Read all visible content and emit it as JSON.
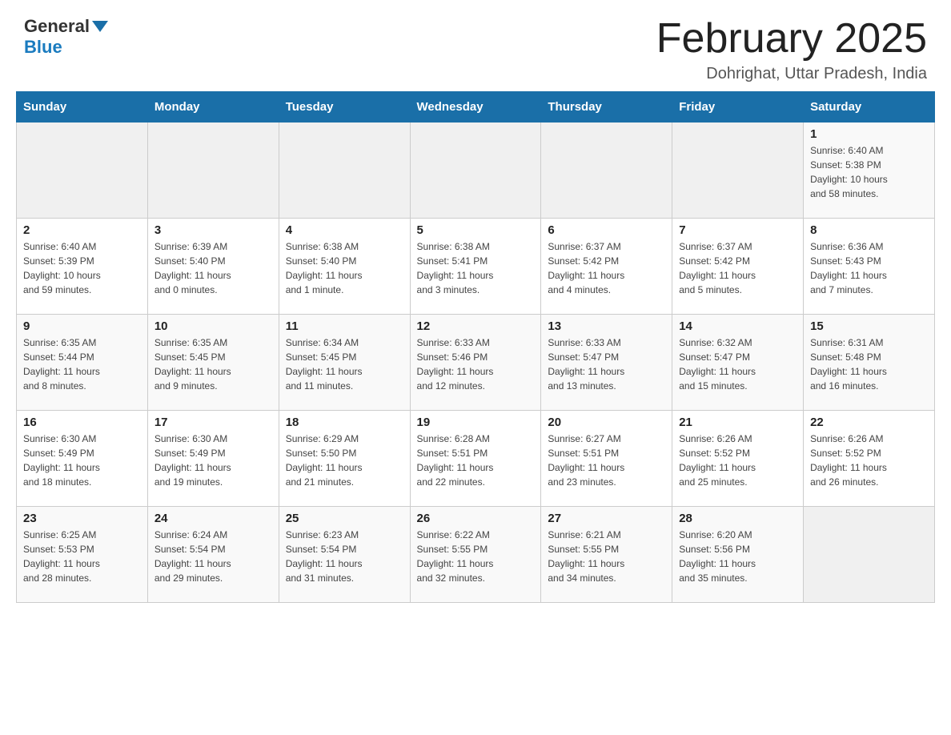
{
  "header": {
    "logo_general": "General",
    "logo_blue": "Blue",
    "month_title": "February 2025",
    "location": "Dohrighat, Uttar Pradesh, India"
  },
  "weekdays": [
    "Sunday",
    "Monday",
    "Tuesday",
    "Wednesday",
    "Thursday",
    "Friday",
    "Saturday"
  ],
  "weeks": [
    [
      {
        "day": "",
        "info": ""
      },
      {
        "day": "",
        "info": ""
      },
      {
        "day": "",
        "info": ""
      },
      {
        "day": "",
        "info": ""
      },
      {
        "day": "",
        "info": ""
      },
      {
        "day": "",
        "info": ""
      },
      {
        "day": "1",
        "info": "Sunrise: 6:40 AM\nSunset: 5:38 PM\nDaylight: 10 hours\nand 58 minutes."
      }
    ],
    [
      {
        "day": "2",
        "info": "Sunrise: 6:40 AM\nSunset: 5:39 PM\nDaylight: 10 hours\nand 59 minutes."
      },
      {
        "day": "3",
        "info": "Sunrise: 6:39 AM\nSunset: 5:40 PM\nDaylight: 11 hours\nand 0 minutes."
      },
      {
        "day": "4",
        "info": "Sunrise: 6:38 AM\nSunset: 5:40 PM\nDaylight: 11 hours\nand 1 minute."
      },
      {
        "day": "5",
        "info": "Sunrise: 6:38 AM\nSunset: 5:41 PM\nDaylight: 11 hours\nand 3 minutes."
      },
      {
        "day": "6",
        "info": "Sunrise: 6:37 AM\nSunset: 5:42 PM\nDaylight: 11 hours\nand 4 minutes."
      },
      {
        "day": "7",
        "info": "Sunrise: 6:37 AM\nSunset: 5:42 PM\nDaylight: 11 hours\nand 5 minutes."
      },
      {
        "day": "8",
        "info": "Sunrise: 6:36 AM\nSunset: 5:43 PM\nDaylight: 11 hours\nand 7 minutes."
      }
    ],
    [
      {
        "day": "9",
        "info": "Sunrise: 6:35 AM\nSunset: 5:44 PM\nDaylight: 11 hours\nand 8 minutes."
      },
      {
        "day": "10",
        "info": "Sunrise: 6:35 AM\nSunset: 5:45 PM\nDaylight: 11 hours\nand 9 minutes."
      },
      {
        "day": "11",
        "info": "Sunrise: 6:34 AM\nSunset: 5:45 PM\nDaylight: 11 hours\nand 11 minutes."
      },
      {
        "day": "12",
        "info": "Sunrise: 6:33 AM\nSunset: 5:46 PM\nDaylight: 11 hours\nand 12 minutes."
      },
      {
        "day": "13",
        "info": "Sunrise: 6:33 AM\nSunset: 5:47 PM\nDaylight: 11 hours\nand 13 minutes."
      },
      {
        "day": "14",
        "info": "Sunrise: 6:32 AM\nSunset: 5:47 PM\nDaylight: 11 hours\nand 15 minutes."
      },
      {
        "day": "15",
        "info": "Sunrise: 6:31 AM\nSunset: 5:48 PM\nDaylight: 11 hours\nand 16 minutes."
      }
    ],
    [
      {
        "day": "16",
        "info": "Sunrise: 6:30 AM\nSunset: 5:49 PM\nDaylight: 11 hours\nand 18 minutes."
      },
      {
        "day": "17",
        "info": "Sunrise: 6:30 AM\nSunset: 5:49 PM\nDaylight: 11 hours\nand 19 minutes."
      },
      {
        "day": "18",
        "info": "Sunrise: 6:29 AM\nSunset: 5:50 PM\nDaylight: 11 hours\nand 21 minutes."
      },
      {
        "day": "19",
        "info": "Sunrise: 6:28 AM\nSunset: 5:51 PM\nDaylight: 11 hours\nand 22 minutes."
      },
      {
        "day": "20",
        "info": "Sunrise: 6:27 AM\nSunset: 5:51 PM\nDaylight: 11 hours\nand 23 minutes."
      },
      {
        "day": "21",
        "info": "Sunrise: 6:26 AM\nSunset: 5:52 PM\nDaylight: 11 hours\nand 25 minutes."
      },
      {
        "day": "22",
        "info": "Sunrise: 6:26 AM\nSunset: 5:52 PM\nDaylight: 11 hours\nand 26 minutes."
      }
    ],
    [
      {
        "day": "23",
        "info": "Sunrise: 6:25 AM\nSunset: 5:53 PM\nDaylight: 11 hours\nand 28 minutes."
      },
      {
        "day": "24",
        "info": "Sunrise: 6:24 AM\nSunset: 5:54 PM\nDaylight: 11 hours\nand 29 minutes."
      },
      {
        "day": "25",
        "info": "Sunrise: 6:23 AM\nSunset: 5:54 PM\nDaylight: 11 hours\nand 31 minutes."
      },
      {
        "day": "26",
        "info": "Sunrise: 6:22 AM\nSunset: 5:55 PM\nDaylight: 11 hours\nand 32 minutes."
      },
      {
        "day": "27",
        "info": "Sunrise: 6:21 AM\nSunset: 5:55 PM\nDaylight: 11 hours\nand 34 minutes."
      },
      {
        "day": "28",
        "info": "Sunrise: 6:20 AM\nSunset: 5:56 PM\nDaylight: 11 hours\nand 35 minutes."
      },
      {
        "day": "",
        "info": ""
      }
    ]
  ],
  "colors": {
    "header_bg": "#1a6fa8",
    "header_text": "#ffffff",
    "accent_blue": "#1a7bbf"
  }
}
